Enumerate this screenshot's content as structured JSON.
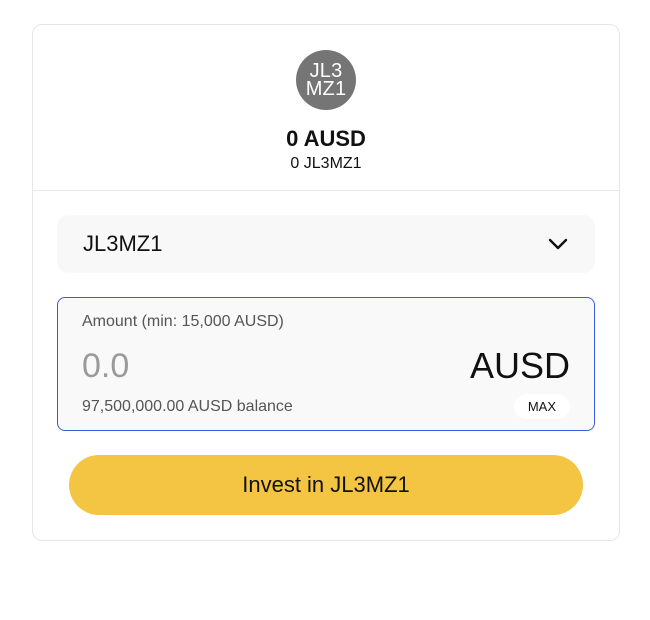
{
  "summary": {
    "avatar_text": "JL3MZ1",
    "total_value": "0 AUSD",
    "token_balance": "0 JL3MZ1"
  },
  "token_select": {
    "selected": "JL3MZ1",
    "icon": "chevron-down-icon"
  },
  "amount": {
    "label": "Amount (min: 15,000 AUSD)",
    "placeholder": "0.0",
    "currency": "AUSD",
    "balance": "97,500,000.00 AUSD balance",
    "max_label": "MAX"
  },
  "invest_button_label": "Invest in JL3MZ1",
  "colors": {
    "accent": "#f4c443",
    "input_border": "#3a5bd9",
    "avatar_bg": "#757575"
  }
}
